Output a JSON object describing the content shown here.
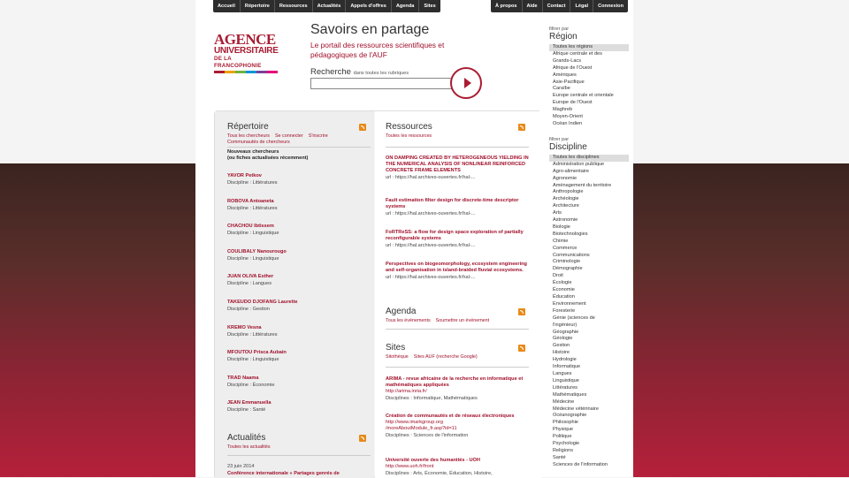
{
  "nav": {
    "left": [
      "Accueil",
      "Répertoire",
      "Ressources",
      "Actualités",
      "Appels d'offres",
      "Agenda",
      "Sites"
    ],
    "right": [
      "À propos",
      "Aide",
      "Contact",
      "Légal",
      "Connexion"
    ]
  },
  "logo": {
    "line1": "AGENCE",
    "line2": "UNIVERSITAIRE",
    "line3": "DE LA FRANCOPHONIE",
    "colors": [
      "#a91c32",
      "#e9a400",
      "#6cb33f",
      "#0094d9",
      "#7b3f98",
      "#e3007a"
    ]
  },
  "hero": {
    "title": "Savoirs en partage",
    "subtitle": "Le portail des ressources scientifiques et pédagogiques de l'AUF",
    "search_label": "Recherche",
    "search_scope": "dans toutes les rubriques",
    "search_value": ""
  },
  "repertoire": {
    "title": "Répertoire",
    "links1": [
      "Tous les chercheurs",
      "Se connecter",
      "S'inscrire"
    ],
    "links2": "Communautés de chercheurs",
    "heading": "Nouveaux chercheurs",
    "subheading": "(ou fiches actualisées récemment)",
    "people": [
      {
        "name": "YAVOR Petkov",
        "disc": "Discipline : Littératures"
      },
      {
        "name": "ROBOVA Antoaneta",
        "disc": "Discipline : Littératures"
      },
      {
        "name": "CHACHOU Ibtissem",
        "disc": "Discipline : Linguistique"
      },
      {
        "name": "COULIBALY Nanourougo",
        "disc": "Discipline : Linguistique"
      },
      {
        "name": "JUAN OLIVA Esther",
        "disc": "Discipline : Langues"
      },
      {
        "name": "TAKEUDO DJOFANG Laurette",
        "disc": "Discipline : Gestion"
      },
      {
        "name": "KREMO Vesna",
        "disc": "Discipline : Littératures"
      },
      {
        "name": "MFOUTOU Prisca Aubain",
        "disc": "Discipline : Linguistique"
      },
      {
        "name": "TRAD Naama",
        "disc": "Discipline : Économie"
      },
      {
        "name": "JEAN Emmanuella",
        "disc": "Discipline : Santé"
      }
    ]
  },
  "actualites": {
    "title": "Actualités",
    "link": "Toutes les actualités",
    "date": "23 juin 2014",
    "item": "Conférence internationale « Partages genrés de"
  },
  "ressources": {
    "title": "Ressources",
    "link": "Toutes les ressources",
    "items": [
      {
        "title": "ON DAMPING CREATED BY HETEROGENEOUS YIELDING IN THE NUMERICAL ANALYSIS OF NONLINEAR REINFORCED CONCRETE FRAME ELEMENTS",
        "url": "url : https://hal.archives-ouvertes.fr/hal-..."
      },
      {
        "title": "Fault estimation filter design for discrete-time descriptor systems",
        "url": "url : https://hal.archives-ouvertes.fr/hal-..."
      },
      {
        "title": "FoRTReSS: a flow for design space exploration of partially reconfigurable systems",
        "url": "url : https://hal.archives-ouvertes.fr/hal-..."
      },
      {
        "title": "Perspectives on biogeomorphology, ecosystem engineering and self-organisation in island-braided fluvial ecosystems.",
        "url": "url : https://hal.archives-ouvertes.fr/hal-..."
      }
    ]
  },
  "agenda": {
    "title": "Agenda",
    "links": [
      "Tous les événements",
      "Soumettre un événement"
    ]
  },
  "sites": {
    "title": "Sites",
    "links": [
      "Sitothèque",
      "Sites AUF (recherche Google)"
    ],
    "items": [
      {
        "title": "ARIMA - revue africaine de la recherche en informatique et mathématiques appliquées",
        "url": "http://arima.inria.fr/",
        "disc": "Disciplines : Informatique, Mathématiques"
      },
      {
        "title": "Création de communautés et de réseaux électroniques",
        "url": "http://www.imarkgroup.org",
        "url2": "/moreAboutModule_fr.asp?id=11",
        "disc": "Disciplines : Sciences de l'information"
      },
      {
        "title": "Université ouverte des humanités - UOH",
        "url": "http://www.uoh.fr/front",
        "disc": "Disciplines : Arts, Économie, Éducation, Histoire,"
      }
    ]
  },
  "sidebar": {
    "region_caption": "filtrer par",
    "region_title": "Région",
    "regions": [
      "Toutes les régions",
      "Afrique centrale et des",
      "Grands-Lacs",
      "Afrique de l'Ouest",
      "Amériques",
      "Asie-Pacifique",
      "Caraïbe",
      "Europe centrale et orientale",
      "Europe de l'Ouest",
      "Maghreb",
      "Moyen-Orient",
      "Océan Indien"
    ],
    "disc_caption": "filtrer par",
    "disc_title": "Discipline",
    "disciplines": [
      "Toutes les disciplines",
      "Administration publique",
      "Agro-alimentaire",
      "Agronomie",
      "Aménagement du territoire",
      "Anthropologie",
      "Archéologie",
      "Architecture",
      "Arts",
      "Astronomie",
      "Biologie",
      "Biotechnologies",
      "Chimie",
      "Commerce",
      "Communications",
      "Criminologie",
      "Démographie",
      "Droit",
      "Écologie",
      "Économie",
      "Éducation",
      "Environnement",
      "Foresterie",
      "Génie (sciences de",
      "l'ingénieur)",
      "Géographie",
      "Géologie",
      "Gestion",
      "Histoire",
      "Hydrologie",
      "Informatique",
      "Langues",
      "Linguistique",
      "Littératures",
      "Mathématiques",
      "Médecine",
      "Médecine vétérinaire",
      "Océanographie",
      "Philosophie",
      "Physique",
      "Politique",
      "Psychologie",
      "Religions",
      "Santé",
      "Sciences de l'information"
    ]
  }
}
